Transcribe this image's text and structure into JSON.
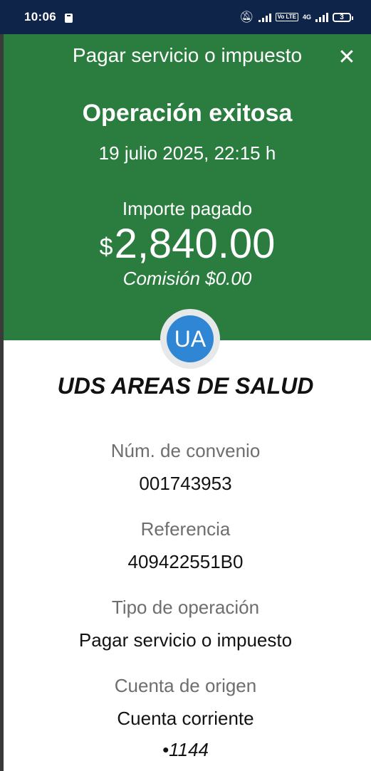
{
  "status_bar": {
    "time": "10:06",
    "volte_label": "Vo LTE",
    "net_label": "4G",
    "battery": "3"
  },
  "header": {
    "title": "Pagar servicio o impuesto",
    "close_symbol": "✕",
    "status": "Operación exitosa",
    "datetime": "19 julio 2025, 22:15 h",
    "amount_label": "Importe pagado",
    "currency": "$",
    "amount": "2,840.00",
    "commission": "Comisión $0.00"
  },
  "merchant": {
    "initials": "UA",
    "name": "UDS AREAS DE SALUD"
  },
  "details": {
    "convenio_label": "Núm. de convenio",
    "convenio_value": "001743953",
    "referencia_label": "Referencia",
    "referencia_value": "409422551B0",
    "tipo_label": "Tipo de operación",
    "tipo_value": "Pagar servicio o impuesto",
    "cuenta_label": "Cuenta de origen",
    "cuenta_value": "Cuenta corriente",
    "cuenta_number": "•1144"
  },
  "colors": {
    "status_bar": "#0f2449",
    "header_green": "#2b7c3f",
    "avatar_blue": "#2f86d4"
  }
}
